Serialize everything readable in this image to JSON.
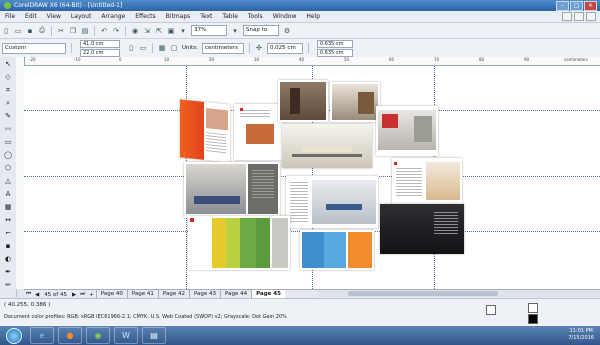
{
  "window": {
    "title": "CorelDRAW X6 (64-Bit) - [Untitled-1]"
  },
  "menu": [
    "File",
    "Edit",
    "View",
    "Layout",
    "Arrange",
    "Effects",
    "Bitmaps",
    "Text",
    "Table",
    "Tools",
    "Window",
    "Help"
  ],
  "toolbar": {
    "zoom": "37%",
    "snap": "Snap to"
  },
  "property_bar": {
    "preset": "Custom",
    "width": "41.0 cm",
    "height": "22.0 cm",
    "units_label": "Units:",
    "units_value": "centimeters",
    "nudge": "0.025 cm",
    "dup_x": "0.635 cm",
    "dup_y": "0.635 cm"
  },
  "ruler_ticks": [
    "-20",
    "-10",
    "0",
    "10",
    "20",
    "30",
    "40",
    "50",
    "60",
    "70",
    "80",
    "90",
    "centimeters"
  ],
  "page_nav": {
    "count": "45 of 45"
  },
  "page_tabs": [
    "Page 40",
    "Page 41",
    "Page 42",
    "Page 43",
    "Page 44",
    "Page 45"
  ],
  "status": {
    "coords": "( 40.255, 0.386 )",
    "profile": "Document color profiles: RGB: sRGB IEC61966-2.1; CMYK: U.S. Web Coated (SWOP) v2; Grayscale: Dot Gain 20%"
  },
  "tray": {
    "time": "11:01 PM",
    "date": "7/15/2016"
  },
  "colors": {
    "accent": "#2b63a8",
    "canvas": "#ffffff",
    "chrome": "#eef2f7"
  },
  "icons": [
    "windows-start-icon",
    "internet-explorer-icon",
    "firefox-icon",
    "corel-icon",
    "word-icon",
    "document-icon"
  ]
}
